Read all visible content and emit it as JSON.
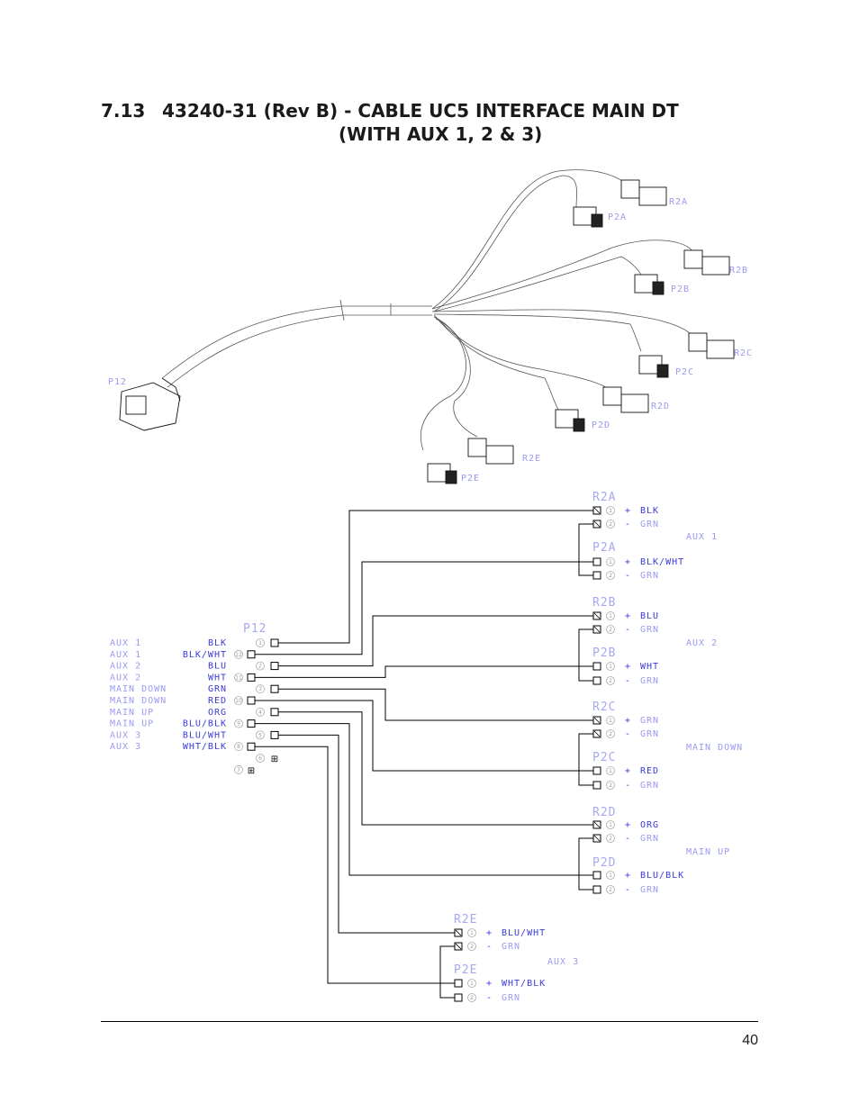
{
  "document": {
    "section_number": "7.13",
    "title_line1": "43240-31 (Rev B) - CABLE UC5 INTERFACE MAIN DT",
    "title_line2": "(WITH AUX 1, 2 & 3)",
    "page_number": "40"
  },
  "drawing": {
    "connector_labels": {
      "main": "P12",
      "r2a": "R2A",
      "p2a": "P2A",
      "r2b": "R2B",
      "p2b": "P2B",
      "r2c": "R2C",
      "p2c": "P2C",
      "r2d": "R2D",
      "p2d": "P2D",
      "r2e": "R2E",
      "p2e": "P2E"
    }
  },
  "schematic": {
    "p12": {
      "label": "P12",
      "pins": [
        {
          "function": "AUX 1",
          "color": "BLK",
          "pin": "1"
        },
        {
          "function": "AUX 1",
          "color": "BLK/WHT",
          "pin": "12"
        },
        {
          "function": "AUX 2",
          "color": "BLU",
          "pin": "2"
        },
        {
          "function": "AUX 2",
          "color": "WHT",
          "pin": "11"
        },
        {
          "function": "MAIN DOWN",
          "color": "GRN",
          "pin": "3"
        },
        {
          "function": "MAIN DOWN",
          "color": "RED",
          "pin": "10"
        },
        {
          "function": "MAIN UP",
          "color": "ORG",
          "pin": "4"
        },
        {
          "function": "MAIN UP",
          "color": "BLU/BLK",
          "pin": "9"
        },
        {
          "function": "AUX 3",
          "color": "BLU/WHT",
          "pin": "5"
        },
        {
          "function": "AUX 3",
          "color": "WHT/BLK",
          "pin": "8"
        },
        {
          "function": "",
          "color": "",
          "pin": "6"
        },
        {
          "function": "",
          "color": "",
          "pin": "7"
        }
      ]
    },
    "groups": [
      {
        "name": "AUX 1",
        "r": {
          "label": "R2A",
          "pins": [
            {
              "pin": "1",
              "sign": "+",
              "color": "BLK"
            },
            {
              "pin": "2",
              "sign": "-",
              "color": "GRN"
            }
          ]
        },
        "p": {
          "label": "P2A",
          "pins": [
            {
              "pin": "1",
              "sign": "+",
              "color": "BLK/WHT"
            },
            {
              "pin": "2",
              "sign": "-",
              "color": "GRN"
            }
          ]
        }
      },
      {
        "name": "AUX 2",
        "r": {
          "label": "R2B",
          "pins": [
            {
              "pin": "1",
              "sign": "+",
              "color": "BLU"
            },
            {
              "pin": "2",
              "sign": "-",
              "color": "GRN"
            }
          ]
        },
        "p": {
          "label": "P2B",
          "pins": [
            {
              "pin": "1",
              "sign": "+",
              "color": "WHT"
            },
            {
              "pin": "2",
              "sign": "-",
              "color": "GRN"
            }
          ]
        }
      },
      {
        "name": "MAIN DOWN",
        "r": {
          "label": "R2C",
          "pins": [
            {
              "pin": "1",
              "sign": "+",
              "color": "GRN"
            },
            {
              "pin": "2",
              "sign": "-",
              "color": "GRN"
            }
          ]
        },
        "p": {
          "label": "P2C",
          "pins": [
            {
              "pin": "1",
              "sign": "+",
              "color": "RED"
            },
            {
              "pin": "2",
              "sign": "-",
              "color": "GRN"
            }
          ]
        }
      },
      {
        "name": "MAIN UP",
        "r": {
          "label": "R2D",
          "pins": [
            {
              "pin": "1",
              "sign": "+",
              "color": "ORG"
            },
            {
              "pin": "2",
              "sign": "-",
              "color": "GRN"
            }
          ]
        },
        "p": {
          "label": "P2D",
          "pins": [
            {
              "pin": "1",
              "sign": "+",
              "color": "BLU/BLK"
            },
            {
              "pin": "2",
              "sign": "-",
              "color": "GRN"
            }
          ]
        }
      },
      {
        "name": "AUX 3",
        "r": {
          "label": "R2E",
          "pins": [
            {
              "pin": "1",
              "sign": "+",
              "color": "BLU/WHT"
            },
            {
              "pin": "2",
              "sign": "-",
              "color": "GRN"
            }
          ]
        },
        "p": {
          "label": "P2E",
          "pins": [
            {
              "pin": "1",
              "sign": "+",
              "color": "WHT/BLK"
            },
            {
              "pin": "2",
              "sign": "-",
              "color": "GRN"
            }
          ]
        }
      }
    ]
  }
}
